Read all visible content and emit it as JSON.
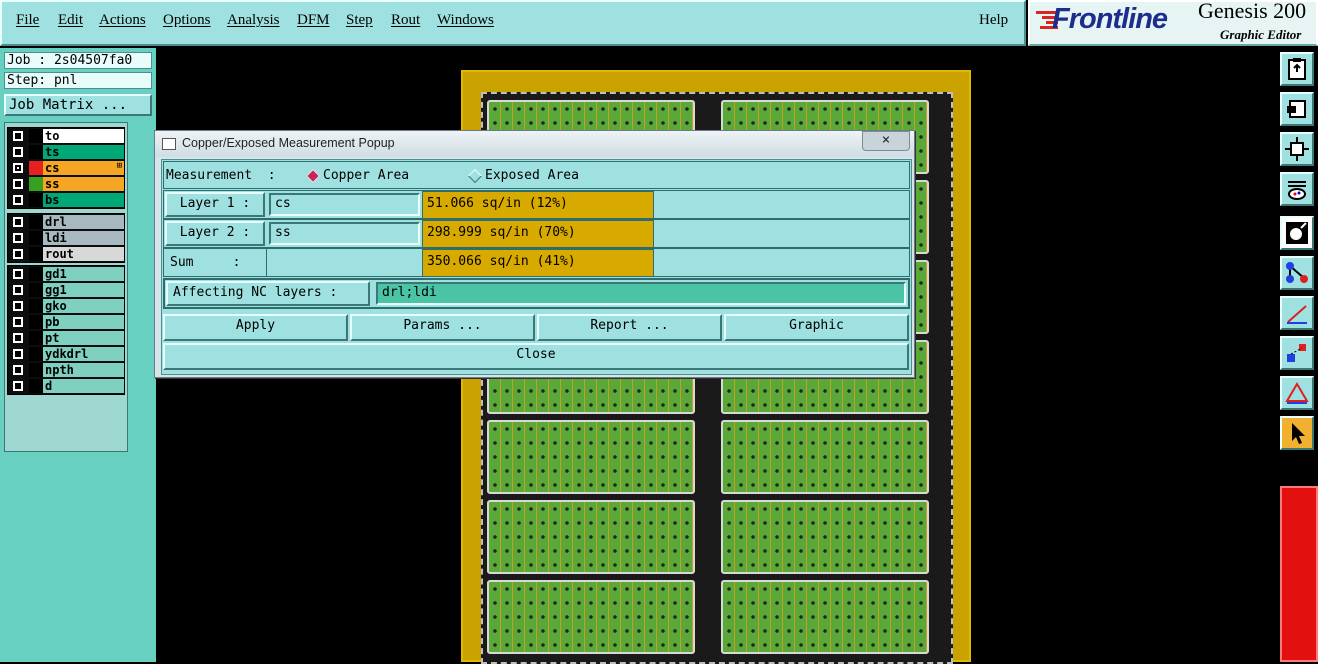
{
  "menu": {
    "file": "File",
    "edit": "Edit",
    "actions": "Actions",
    "options": "Options",
    "analysis": "Analysis",
    "dfm": "DFM",
    "step": "Step",
    "rout": "Rout",
    "windows": "Windows",
    "help": "Help"
  },
  "logo": {
    "brand": "Frontline",
    "product": "Genesis 200",
    "subtitle": "Graphic Editor"
  },
  "left_panel": {
    "job": "Job : 2s04507fa0",
    "step": "Step: pnl",
    "job_matrix_button": "Job Matrix ...",
    "layer_groups": [
      [
        {
          "name": "to",
          "checked": false,
          "swatch": "#000000",
          "bg": "#ffffff"
        },
        {
          "name": "ts",
          "checked": false,
          "swatch": "#000000",
          "bg": "#00a878"
        },
        {
          "name": "cs",
          "checked": true,
          "swatch": "#e52020",
          "bg": "#f5a623",
          "mark": "⊞"
        },
        {
          "name": "ss",
          "checked": false,
          "swatch": "#38a020",
          "bg": "#f5a623"
        },
        {
          "name": "bs",
          "checked": false,
          "swatch": "#000000",
          "bg": "#00a878"
        }
      ],
      [
        {
          "name": "drl",
          "checked": false,
          "swatch": "#000000",
          "bg": "#a7b8c0"
        },
        {
          "name": "ldi",
          "checked": false,
          "swatch": "#000000",
          "bg": "#a7b8c0"
        },
        {
          "name": "rout",
          "checked": false,
          "swatch": "#000000",
          "bg": "#d8d8d8"
        }
      ],
      [
        {
          "name": "gd1",
          "checked": false,
          "swatch": "#000000",
          "bg": "#7fd0c0"
        },
        {
          "name": "gg1",
          "checked": false,
          "swatch": "#000000",
          "bg": "#7fd0c0"
        },
        {
          "name": "gko",
          "checked": false,
          "swatch": "#000000",
          "bg": "#7fd0c0"
        },
        {
          "name": "pb",
          "checked": false,
          "swatch": "#000000",
          "bg": "#7fd0c0"
        },
        {
          "name": "pt",
          "checked": false,
          "swatch": "#000000",
          "bg": "#7fd0c0"
        },
        {
          "name": "ydkdrl",
          "checked": false,
          "swatch": "#000000",
          "bg": "#7fd0c0"
        },
        {
          "name": "npth",
          "checked": false,
          "swatch": "#000000",
          "bg": "#7fd0c0"
        },
        {
          "name": "d",
          "checked": false,
          "swatch": "#000000",
          "bg": "#7fd0c0"
        }
      ]
    ]
  },
  "dialog": {
    "title": "Copper/Exposed Measurement Popup",
    "close_glyph": "×",
    "measurement_label": "Measurement  :",
    "copper_area_label": "Copper Area",
    "exposed_area_label": "Exposed Area",
    "selected_mode": "copper",
    "layer1_label": "Layer 1 :",
    "layer1_value": "cs",
    "layer1_result": "51.066 sq/in (12%)",
    "layer2_label": "Layer 2 :",
    "layer2_value": "ss",
    "layer2_result": "298.999 sq/in (70%)",
    "sum_label": "Sum     :",
    "sum_result": "350.066 sq/in (41%)",
    "affecting_label": "Affecting NC layers :",
    "affecting_value": "drl;ldi",
    "apply_button": "Apply",
    "params_button": "Params ...",
    "report_button": "Report ...",
    "graphic_button": "Graphic",
    "close_button": "Close"
  },
  "toolbar": {
    "icons": [
      "clipboard-icon",
      "window-icon",
      "fit-icon",
      "palette-icon",
      "gear-box-icon",
      "network-icon",
      "measure-icon",
      "snap-icon",
      "triangle-icon",
      "pointer-icon"
    ]
  }
}
